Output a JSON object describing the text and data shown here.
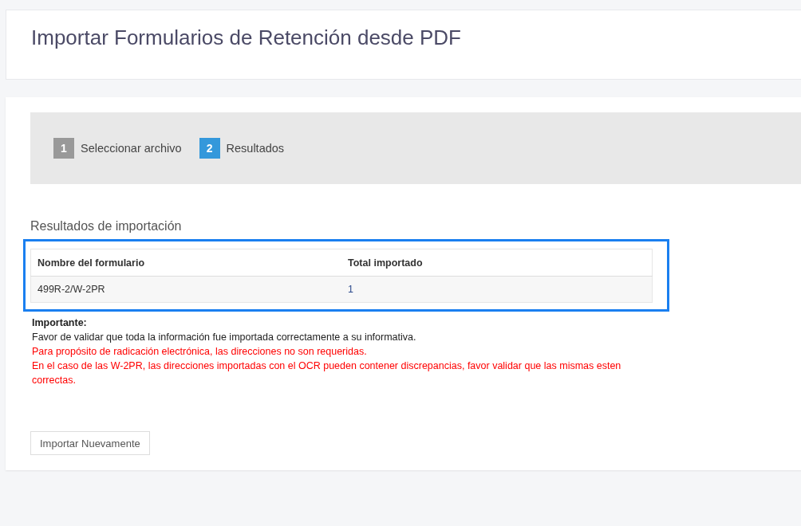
{
  "page_title": "Importar Formularios de Retención desde PDF",
  "steps": [
    {
      "number": "1",
      "label": "Seleccionar archivo",
      "selected": false
    },
    {
      "number": "2",
      "label": "Resultados",
      "selected": true
    }
  ],
  "results": {
    "heading": "Resultados de importación",
    "highlighted": true,
    "table": {
      "columns": [
        "Nombre del formulario",
        "Total importado"
      ],
      "rows": [
        [
          "499R-2/W-2PR",
          "1"
        ]
      ]
    }
  },
  "notes": {
    "title": "Importante:",
    "lines": [
      {
        "kind": "info",
        "text": "Favor de validar que toda la información fue importada correctamente a su informativa."
      },
      {
        "kind": "warning",
        "text": "Para propósito de radicación electrónica, las direcciones no son requeridas."
      },
      {
        "kind": "warning",
        "text": "En el caso de las W-2PR, las direcciones importadas con el OCR pueden contener discrepancias, favor validar que las mismas esten correctas."
      }
    ]
  },
  "buttons": [
    {
      "label": "Importar Nuevamente"
    }
  ]
}
